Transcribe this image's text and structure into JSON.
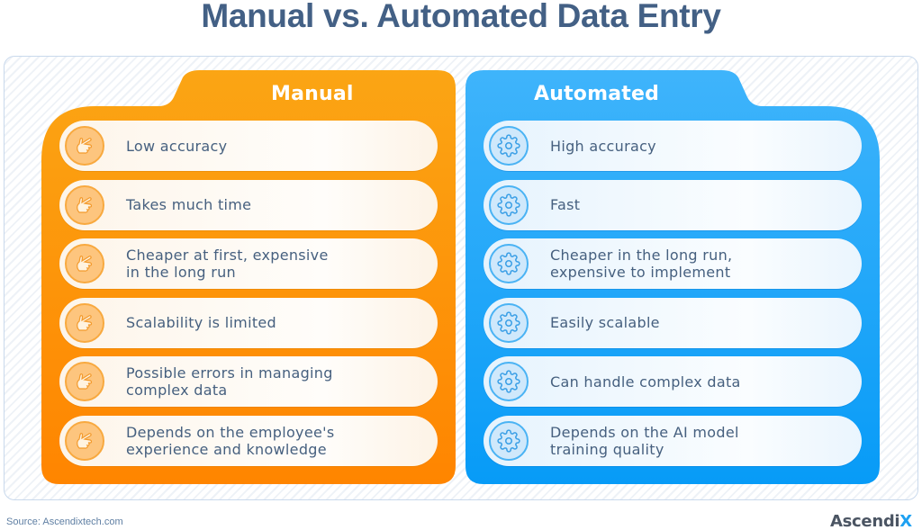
{
  "title": "Manual vs. Automated Data Entry",
  "colors": {
    "title": "#436085",
    "manual_top": "#fba514",
    "manual_bottom": "#ff8500",
    "automated_top": "#3fb4fb",
    "automated_bottom": "#079bf7",
    "text": "#46607f"
  },
  "manual": {
    "heading": "Manual",
    "icon": "pointing-hand-icon",
    "items": [
      {
        "text": "Low accuracy"
      },
      {
        "text": "Takes much time"
      },
      {
        "text": "Cheaper at first, expensive\nin the long run"
      },
      {
        "text": "Scalability is limited"
      },
      {
        "text": "Possible errors in managing\ncomplex data"
      },
      {
        "text": "Depends on the employee's\nexperience and knowledge"
      }
    ]
  },
  "automated": {
    "heading": "Automated",
    "icon": "gear-icon",
    "items": [
      {
        "text": "High accuracy"
      },
      {
        "text": "Fast"
      },
      {
        "text": "Cheaper in the long run,\nexpensive to implement"
      },
      {
        "text": "Easily scalable"
      },
      {
        "text": "Can handle complex data"
      },
      {
        "text": "Depends on the AI model\ntraining quality"
      }
    ]
  },
  "footer": {
    "source": "Source: Ascendixtech.com",
    "brand_main": "Ascendi",
    "brand_accent": "X"
  }
}
